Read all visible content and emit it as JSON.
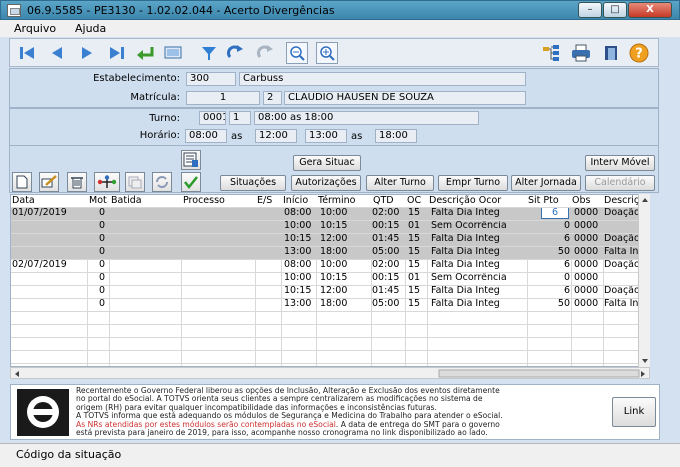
{
  "window": {
    "title": "06.9.5585 - PE3130 - 1.02.02.044 - Acerto Divergências",
    "min": "–",
    "max": "□",
    "close": "X"
  },
  "menu": {
    "arquivo": "Arquivo",
    "ajuda": "Ajuda"
  },
  "header": {
    "estabelecimento_label": "Estabelecimento:",
    "estabelecimento_code": "300",
    "estabelecimento_name": "Carbuss",
    "matricula_label": "Matrícula:",
    "matricula_code": "1",
    "matricula_digit": "2",
    "matricula_name": "CLAUDIO HAUSEN DE SOUZA",
    "turno_label": "Turno:",
    "turno_code": "0001",
    "turno_seq": "1",
    "turno_desc": "08:00 as 18:00",
    "horario_label": "Horário:",
    "h1": "08:00",
    "as1": "as",
    "h2": "12:00",
    "h3": "13:00",
    "as2": "as",
    "h4": "18:00"
  },
  "buttons": {
    "gera_situac": "Gera Situac",
    "interv_movel": "Interv Móvel",
    "situacoes": "Situações",
    "autorizacoes": "Autorizações",
    "alter_turno": "Alter Turno",
    "empr_turno": "Empr Turno",
    "alter_jornada": "Alter Jornada",
    "calendario": "Calendário",
    "link": "Link"
  },
  "columns": [
    "Data",
    "Mot",
    "Batida",
    "Processo",
    "E/S",
    "Início",
    "Término",
    "QTD",
    "OC",
    "Descrição Ocor",
    "Sit Pto",
    "Obs",
    "Descriçã"
  ],
  "rows": [
    {
      "data": "01/07/2019",
      "mot": "0",
      "inicio": "08:00",
      "termino": "10:00",
      "qtd": "02:00",
      "oc": "15",
      "desc": "Falta Dia Integ",
      "sit": "6",
      "obs": "0000",
      "desc2": "Doação",
      "sel": true
    },
    {
      "data": "",
      "mot": "0",
      "inicio": "10:00",
      "termino": "10:15",
      "qtd": "00:15",
      "oc": "01",
      "desc": "Sem Ocorrência",
      "sit": "0",
      "obs": "0000",
      "desc2": "",
      "sel": true
    },
    {
      "data": "",
      "mot": "0",
      "inicio": "10:15",
      "termino": "12:00",
      "qtd": "01:45",
      "oc": "15",
      "desc": "Falta Dia Integ",
      "sit": "6",
      "obs": "0000",
      "desc2": "Doação",
      "sel": true
    },
    {
      "data": "",
      "mot": "0",
      "inicio": "13:00",
      "termino": "18:00",
      "qtd": "05:00",
      "oc": "15",
      "desc": "Falta Dia Integ",
      "sit": "50",
      "obs": "0000",
      "desc2": "Falta In",
      "sel": true
    },
    {
      "data": "02/07/2019",
      "mot": "0",
      "inicio": "08:00",
      "termino": "10:00",
      "qtd": "02:00",
      "oc": "15",
      "desc": "Falta Dia Integ",
      "sit": "6",
      "obs": "0000",
      "desc2": "Doação",
      "sel": false
    },
    {
      "data": "",
      "mot": "0",
      "inicio": "10:00",
      "termino": "10:15",
      "qtd": "00:15",
      "oc": "01",
      "desc": "Sem Ocorrência",
      "sit": "0",
      "obs": "0000",
      "desc2": "",
      "sel": false
    },
    {
      "data": "",
      "mot": "0",
      "inicio": "10:15",
      "termino": "12:00",
      "qtd": "01:45",
      "oc": "15",
      "desc": "Falta Dia Integ",
      "sit": "6",
      "obs": "0000",
      "desc2": "Doação",
      "sel": false
    },
    {
      "data": "",
      "mot": "0",
      "inicio": "13:00",
      "termino": "18:00",
      "qtd": "05:00",
      "oc": "15",
      "desc": "Falta Dia Integ",
      "sit": "50",
      "obs": "0000",
      "desc2": "Falta In",
      "sel": false
    }
  ],
  "notice": {
    "l1": "Recentemente o Governo Federal liberou as opções de Inclusão, Alteração e Exclusão dos eventos diretamente",
    "l2": "no portal do eSocial. A TOTVS orienta seus clientes a sempre centralizarem as modificações no sistema de",
    "l3": "origem (RH) para evitar qualquer incompatibilidade das informações e inconsistências futuras.",
    "l4": "A TOTVS informa que está adequando os módulos de Segurança e Medicina do Trabalho para atender o eSocial.",
    "l5_red": "As NRs atendidas por estes módulos serão contempladas no eSocial",
    "l5_rest": ". A data de entrega do SMT para o governo",
    "l6": "está prevista para janeiro de 2019, para isso, acompanhe nosso cronograma no link disponibilizado ao lado."
  },
  "status": {
    "text": "Código da situação"
  }
}
